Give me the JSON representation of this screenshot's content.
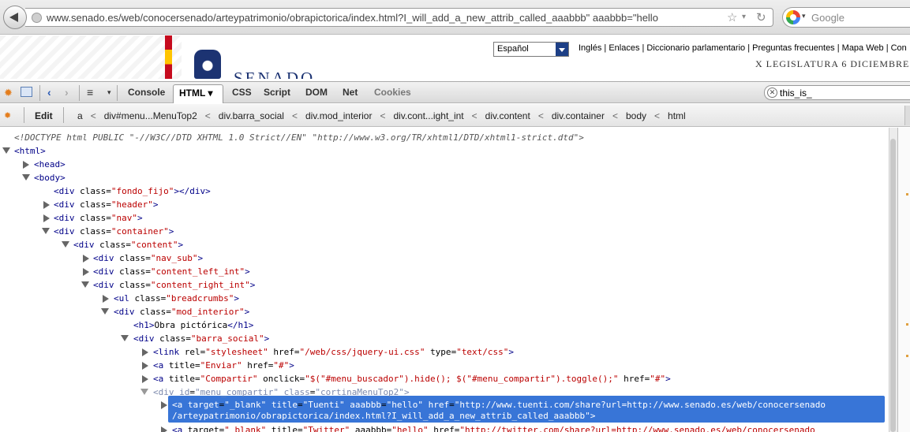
{
  "browser": {
    "url": "www.senado.es/web/conocersenado/arteypatrimonio/obrapictorica/index.html?I_will_add_a_new_attrib_called_aaabbb\" aaabbb=\"hello",
    "star_icon": "star-icon",
    "reload_icon": "reload-icon",
    "search_placeholder": "Google"
  },
  "site": {
    "logo_text": "SENADO",
    "language_selected": "Español",
    "links": "Inglés | Enlaces | Diccionario parlamentario | Preguntas frecuentes | Mapa Web | Con",
    "legislatura": "X LEGISLATURA  6 DICIEMBRE"
  },
  "firebug": {
    "tabs": {
      "console": "Console",
      "html": "HTML ▾",
      "css": "CSS",
      "script": "Script",
      "dom": "DOM",
      "net": "Net",
      "cookies": "Cookies"
    },
    "search_value": "this_is_",
    "edit_label": "Edit",
    "breadcrumbs": [
      "a",
      "div#menu...MenuTop2",
      "div.barra_social",
      "div.mod_interior",
      "div.cont...ight_int",
      "div.content",
      "div.container",
      "body",
      "html"
    ]
  },
  "html_tree": {
    "doctype": "<!DOCTYPE html PUBLIC \"-//W3C//DTD XHTML 1.0 Strict//EN\" \"http://www.w3.org/TR/xhtml1/DTD/xhtml1-strict.dtd\">",
    "html": "html",
    "head": "head",
    "body": "body",
    "div": "div",
    "class": "class",
    "fondo_fijo": "fondo_fijo",
    "header": "header",
    "nav": "nav",
    "container": "container",
    "content": "content",
    "nav_sub": "nav_sub",
    "content_left_int": "content_left_int",
    "content_right_int": "content_right_int",
    "ul": "ul",
    "breadcrumbs": "breadcrumbs",
    "mod_interior": "mod_interior",
    "h1": "h1",
    "h1_text": "Obra pictórica",
    "barra_social": "barra_social",
    "link": "link",
    "rel": "rel",
    "stylesheet": "stylesheet",
    "href": "href",
    "jquery_css": "/web/css/jquery-ui.css",
    "type": "type",
    "text_css": "text/css",
    "a": "a",
    "title": "title",
    "enviar": "Enviar",
    "hash": "#",
    "compartir": "Compartir",
    "onclick": "onclick",
    "onclick_value": "$(\"#menu_buscador\").hide(); $(\"#menu_compartir\").toggle();",
    "id": "id",
    "menu_compartir": "menu_compartir",
    "cortina": "cortinaMenuTop2",
    "target": "target",
    "blank": "_blank",
    "tuenti": "Tuenti",
    "aaabbb": "aaabbb",
    "hello": "hello",
    "tuenti_href_1": "http://www.tuenti.com/share?url=http://www.senado.es/web/conocersenado",
    "tuenti_href_2": "/arteypatrimonio/obrapictorica/index.html?I_will_add_a_new_attrib_called_aaabbb",
    "twitter": "Twitter",
    "twitter_href": "http://twitter.com/share?url=http://www.senado.es/web/conocersenado"
  }
}
